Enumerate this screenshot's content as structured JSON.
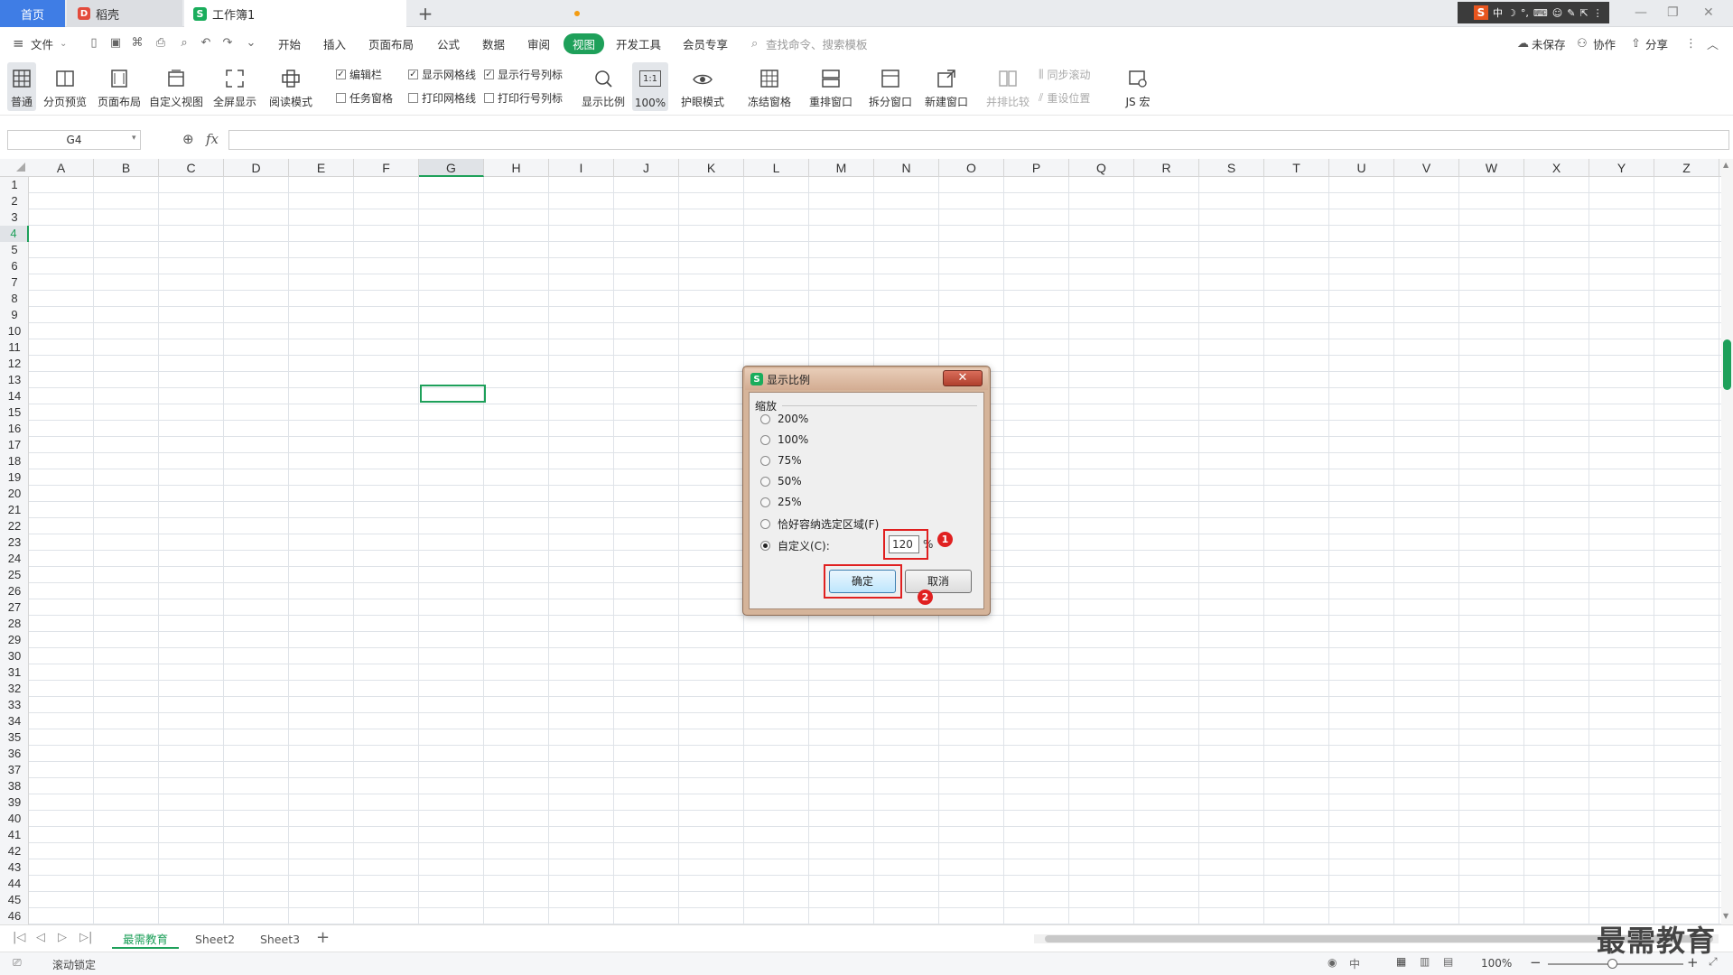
{
  "tabs": {
    "home": "首页",
    "daoke": "稻壳",
    "workbook": "工作簿1",
    "new_tab": "+"
  },
  "ime": {
    "s": "S",
    "cn": "中"
  },
  "menu": {
    "file": "文件",
    "items": [
      "开始",
      "插入",
      "页面布局",
      "公式",
      "数据",
      "审阅",
      "视图",
      "开发工具",
      "会员专享"
    ],
    "active": "视图",
    "search_placeholder": "查找命令、搜索模板",
    "unsaved": "未保存",
    "collab": "协作",
    "share": "分享"
  },
  "ribbon": {
    "normal": "普通",
    "page_break": "分页预览",
    "page_layout": "页面布局",
    "custom_view": "自定义视图",
    "fullscreen": "全屏显示",
    "reading": "阅读模式",
    "chk_editbar": "编辑栏",
    "chk_taskpane": "任务窗格",
    "chk_show_grid": "显示网格线",
    "chk_print_grid": "打印网格线",
    "chk_show_headers": "显示行号列标",
    "chk_print_headers": "打印行号列标",
    "zoom": "显示比例",
    "zoom100": "100%",
    "zoom100_icon": "1:1",
    "eye": "护眼模式",
    "freeze": "冻结窗格",
    "arrange": "重排窗口",
    "split": "拆分窗口",
    "new_window": "新建窗口",
    "side_by_side": "并排比较",
    "sync_scroll": "同步滚动",
    "reset_pos": "重设位置",
    "macro": "JS 宏"
  },
  "formula": {
    "namebox": "G4",
    "fx": "fx"
  },
  "columns": [
    "A",
    "B",
    "C",
    "D",
    "E",
    "F",
    "G",
    "H",
    "I",
    "J",
    "K",
    "L",
    "M",
    "N",
    "O",
    "P",
    "Q",
    "R",
    "S",
    "T",
    "U",
    "V",
    "W",
    "X",
    "Y",
    "Z"
  ],
  "rows": [
    "1",
    "2",
    "3",
    "4",
    "5",
    "6",
    "7",
    "8",
    "9",
    "10",
    "11",
    "12",
    "13",
    "14",
    "15",
    "16",
    "17",
    "18",
    "19",
    "20",
    "21",
    "22",
    "23",
    "24",
    "25",
    "26",
    "27",
    "28",
    "29",
    "30",
    "31",
    "32",
    "33",
    "34",
    "35",
    "36",
    "37",
    "38",
    "39",
    "40",
    "41",
    "42",
    "43",
    "44",
    "45",
    "46"
  ],
  "dialog": {
    "title": "显示比例",
    "group": "缩放",
    "options": [
      "200%",
      "100%",
      "75%",
      "50%",
      "25%",
      "恰好容纳选定区域(F)",
      "自定义(C):"
    ],
    "selected": "自定义(C):",
    "custom_value": "120",
    "percent": "%",
    "ok": "确定",
    "cancel": "取消",
    "badge1": "1",
    "badge2": "2"
  },
  "sheets": [
    "最需教育",
    "Sheet2",
    "Sheet3"
  ],
  "status": {
    "scroll_lock": "滚动锁定",
    "zoom": "100%"
  },
  "watermark": "最需教育",
  "colors": {
    "accent": "#1ea05a",
    "home_tab": "#3f7de5",
    "highlight": "#e02020"
  }
}
